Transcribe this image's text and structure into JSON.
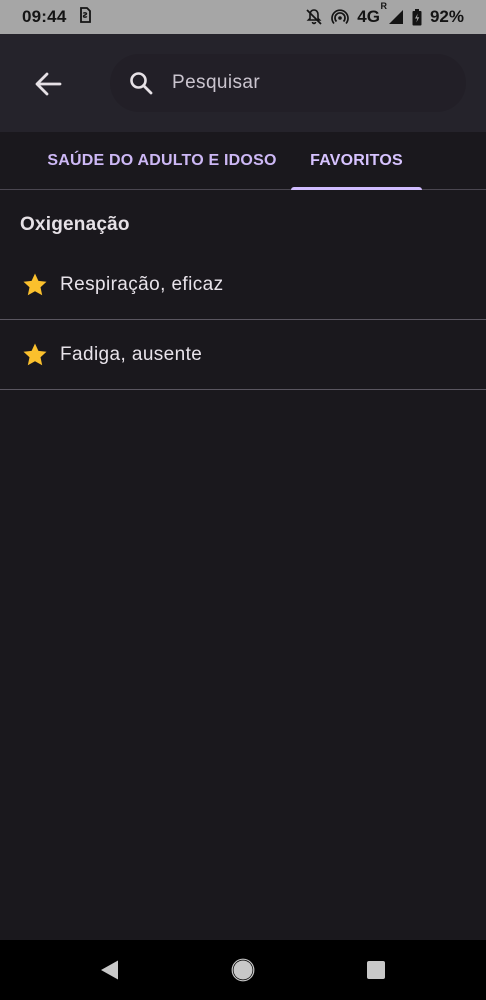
{
  "status_bar": {
    "time": "09:44",
    "network": "4G",
    "roaming": "R",
    "battery": "92%"
  },
  "app_bar": {
    "search_placeholder": "Pesquisar"
  },
  "tabs": [
    {
      "label": "SAÚDE DO ADULTO E IDOSO",
      "selected": false
    },
    {
      "label": "FAVORITOS",
      "selected": true
    }
  ],
  "content": {
    "section_title": "Oxigenação",
    "items": [
      {
        "label": "Respiração, eficaz",
        "icon": "star-icon",
        "favorite": true
      },
      {
        "label": "Fadiga, ausente",
        "icon": "star-icon",
        "favorite": true
      }
    ]
  },
  "colors": {
    "accent": "#d0bcff",
    "star": "#fbc02d",
    "background": "#1a181d",
    "app_bar": "#25232b"
  }
}
